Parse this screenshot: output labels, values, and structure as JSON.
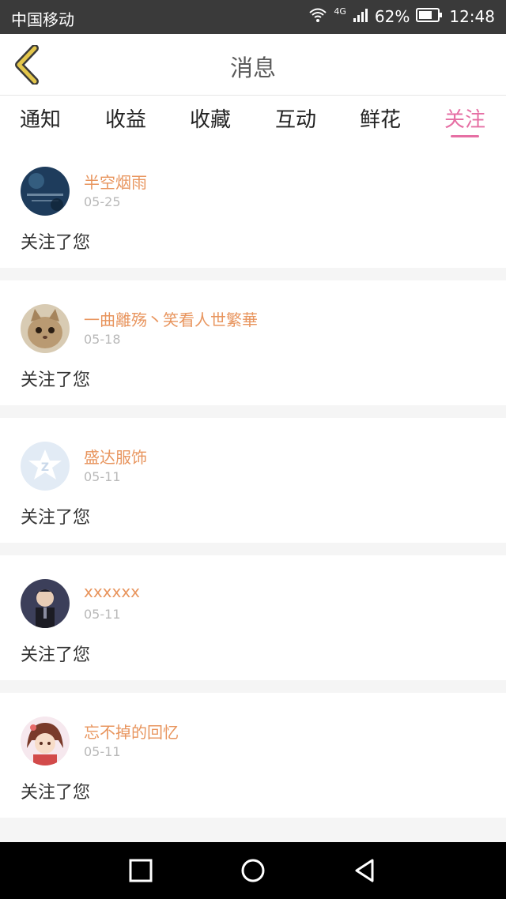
{
  "status_bar": {
    "carrier": "中国移动",
    "network": "4G",
    "battery": "62%",
    "time": "12:48"
  },
  "header": {
    "title": "消息"
  },
  "tabs": [
    {
      "label": "通知"
    },
    {
      "label": "收益"
    },
    {
      "label": "收藏"
    },
    {
      "label": "互动"
    },
    {
      "label": "鲜花"
    },
    {
      "label": "关注",
      "active": true
    }
  ],
  "messages": [
    {
      "name": "半空烟雨",
      "date": "05-25",
      "text": "关注了您"
    },
    {
      "name": "一曲離殇丶笑看人世繁華",
      "date": "05-18",
      "text": "关注了您"
    },
    {
      "name": "盛达服饰",
      "date": "05-11",
      "text": "关注了您"
    },
    {
      "name": "xxxxxx",
      "date": "05-11",
      "text": "关注了您"
    },
    {
      "name": "忘不掉的回忆",
      "date": "05-11",
      "text": "关注了您"
    }
  ],
  "colors": {
    "accent": "#e66fa4",
    "username": "#e8955e",
    "back_icon": "#e3c64b"
  }
}
